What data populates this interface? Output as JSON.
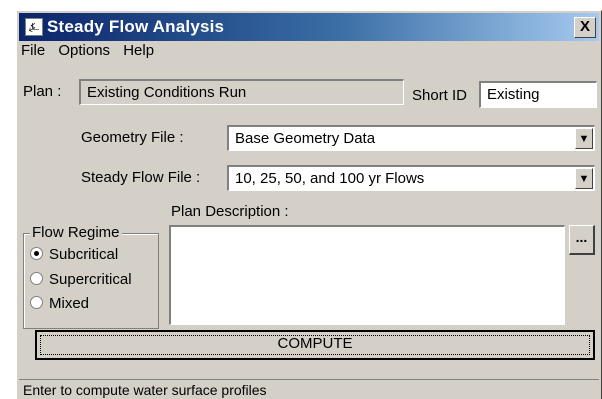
{
  "window": {
    "title": "Steady Flow Analysis",
    "close_glyph": "X",
    "icon": "app-icon"
  },
  "menu": [
    "File",
    "Options",
    "Help"
  ],
  "plan": {
    "label": "Plan :",
    "value": "Existing Conditions Run",
    "short_id_label": "Short ID",
    "short_id_value": "Existing"
  },
  "geometry": {
    "label": "Geometry File :",
    "value": "Base Geometry Data"
  },
  "steady_flow": {
    "label": "Steady Flow File :",
    "value": "10, 25, 50, and 100 yr Flows"
  },
  "flow_regime": {
    "title": "Flow Regime",
    "options": [
      "Subcritical",
      "Supercritical",
      "Mixed"
    ],
    "selected": "Subcritical"
  },
  "plan_description": {
    "label": "Plan Description :",
    "value": "",
    "button_label": "..."
  },
  "compute_label": "COMPUTE",
  "status_text": "Enter to compute water surface profiles"
}
